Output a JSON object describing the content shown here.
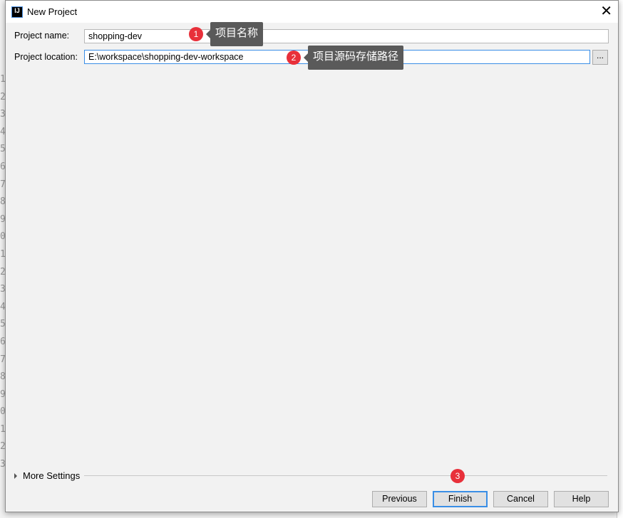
{
  "window": {
    "title": "New Project",
    "icon": "intellij-icon",
    "icon_text": "IJ"
  },
  "form": {
    "name_label": "Project name:",
    "name_value": "shopping-dev",
    "location_label": "Project location:",
    "location_value": "E:\\workspace\\shopping-dev-workspace",
    "browse_label": "..."
  },
  "annotations": [
    {
      "number": "1",
      "text": "项目名称"
    },
    {
      "number": "2",
      "text": "项目源码存储路径"
    },
    {
      "number": "3",
      "text": ""
    }
  ],
  "more_settings": "More Settings",
  "buttons": {
    "previous": "Previous",
    "finish": "Finish",
    "cancel": "Cancel",
    "help": "Help"
  },
  "colors": {
    "accent": "#3a8ee6",
    "badge": "#e8303a",
    "tooltip": "#5a5a5a"
  }
}
